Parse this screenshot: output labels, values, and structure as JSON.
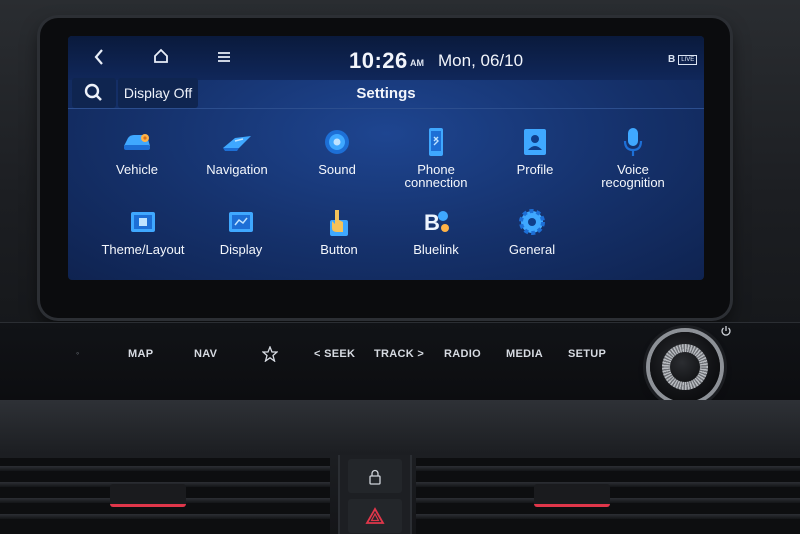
{
  "topbar": {
    "back_icon": "chevron-left-icon",
    "home_icon": "home-icon",
    "menu_icon": "hamburger-menu-icon",
    "time": "10:26",
    "ampm": "AM",
    "date": "Mon, 06/10",
    "bt_icon": "B",
    "live_badge": "LIVE"
  },
  "header": {
    "search_icon": "search-icon",
    "display_off_label": "Display Off",
    "title": "Settings"
  },
  "tiles": [
    {
      "label": "Vehicle",
      "icon": "vehicle-icon"
    },
    {
      "label": "Navigation",
      "icon": "navigation-icon"
    },
    {
      "label": "Sound",
      "icon": "speaker-icon"
    },
    {
      "label": "Phone connection",
      "label_line1": "Phone",
      "label_line2": "connection",
      "icon": "phone-icon"
    },
    {
      "label": "Profile",
      "icon": "profile-card-icon"
    },
    {
      "label": "Voice recognition",
      "label_line1": "Voice",
      "label_line2": "recognition",
      "icon": "microphone-icon"
    },
    {
      "label": "Theme/Layout",
      "icon": "theme-icon"
    },
    {
      "label": "Display",
      "icon": "display-icon"
    },
    {
      "label": "Button",
      "icon": "button-press-icon"
    },
    {
      "label": "Bluelink",
      "icon": "bluelink-icon"
    },
    {
      "label": "General",
      "icon": "gear-icon"
    }
  ],
  "hardkeys": {
    "map": "MAP",
    "nav": "NAV",
    "star_icon": "star-icon",
    "seek": "< SEEK",
    "track": "TRACK >",
    "radio": "RADIO",
    "media": "MEDIA",
    "setup": "SETUP",
    "power_icon": "power-icon"
  },
  "lower": {
    "lock_icon": "lock-icon",
    "hazard_icon": "hazard-triangle-icon"
  },
  "colors": {
    "screen_bg": "#15316b",
    "accent_blue": "#2f8fff",
    "vent_tab_red": "#e0364a"
  }
}
